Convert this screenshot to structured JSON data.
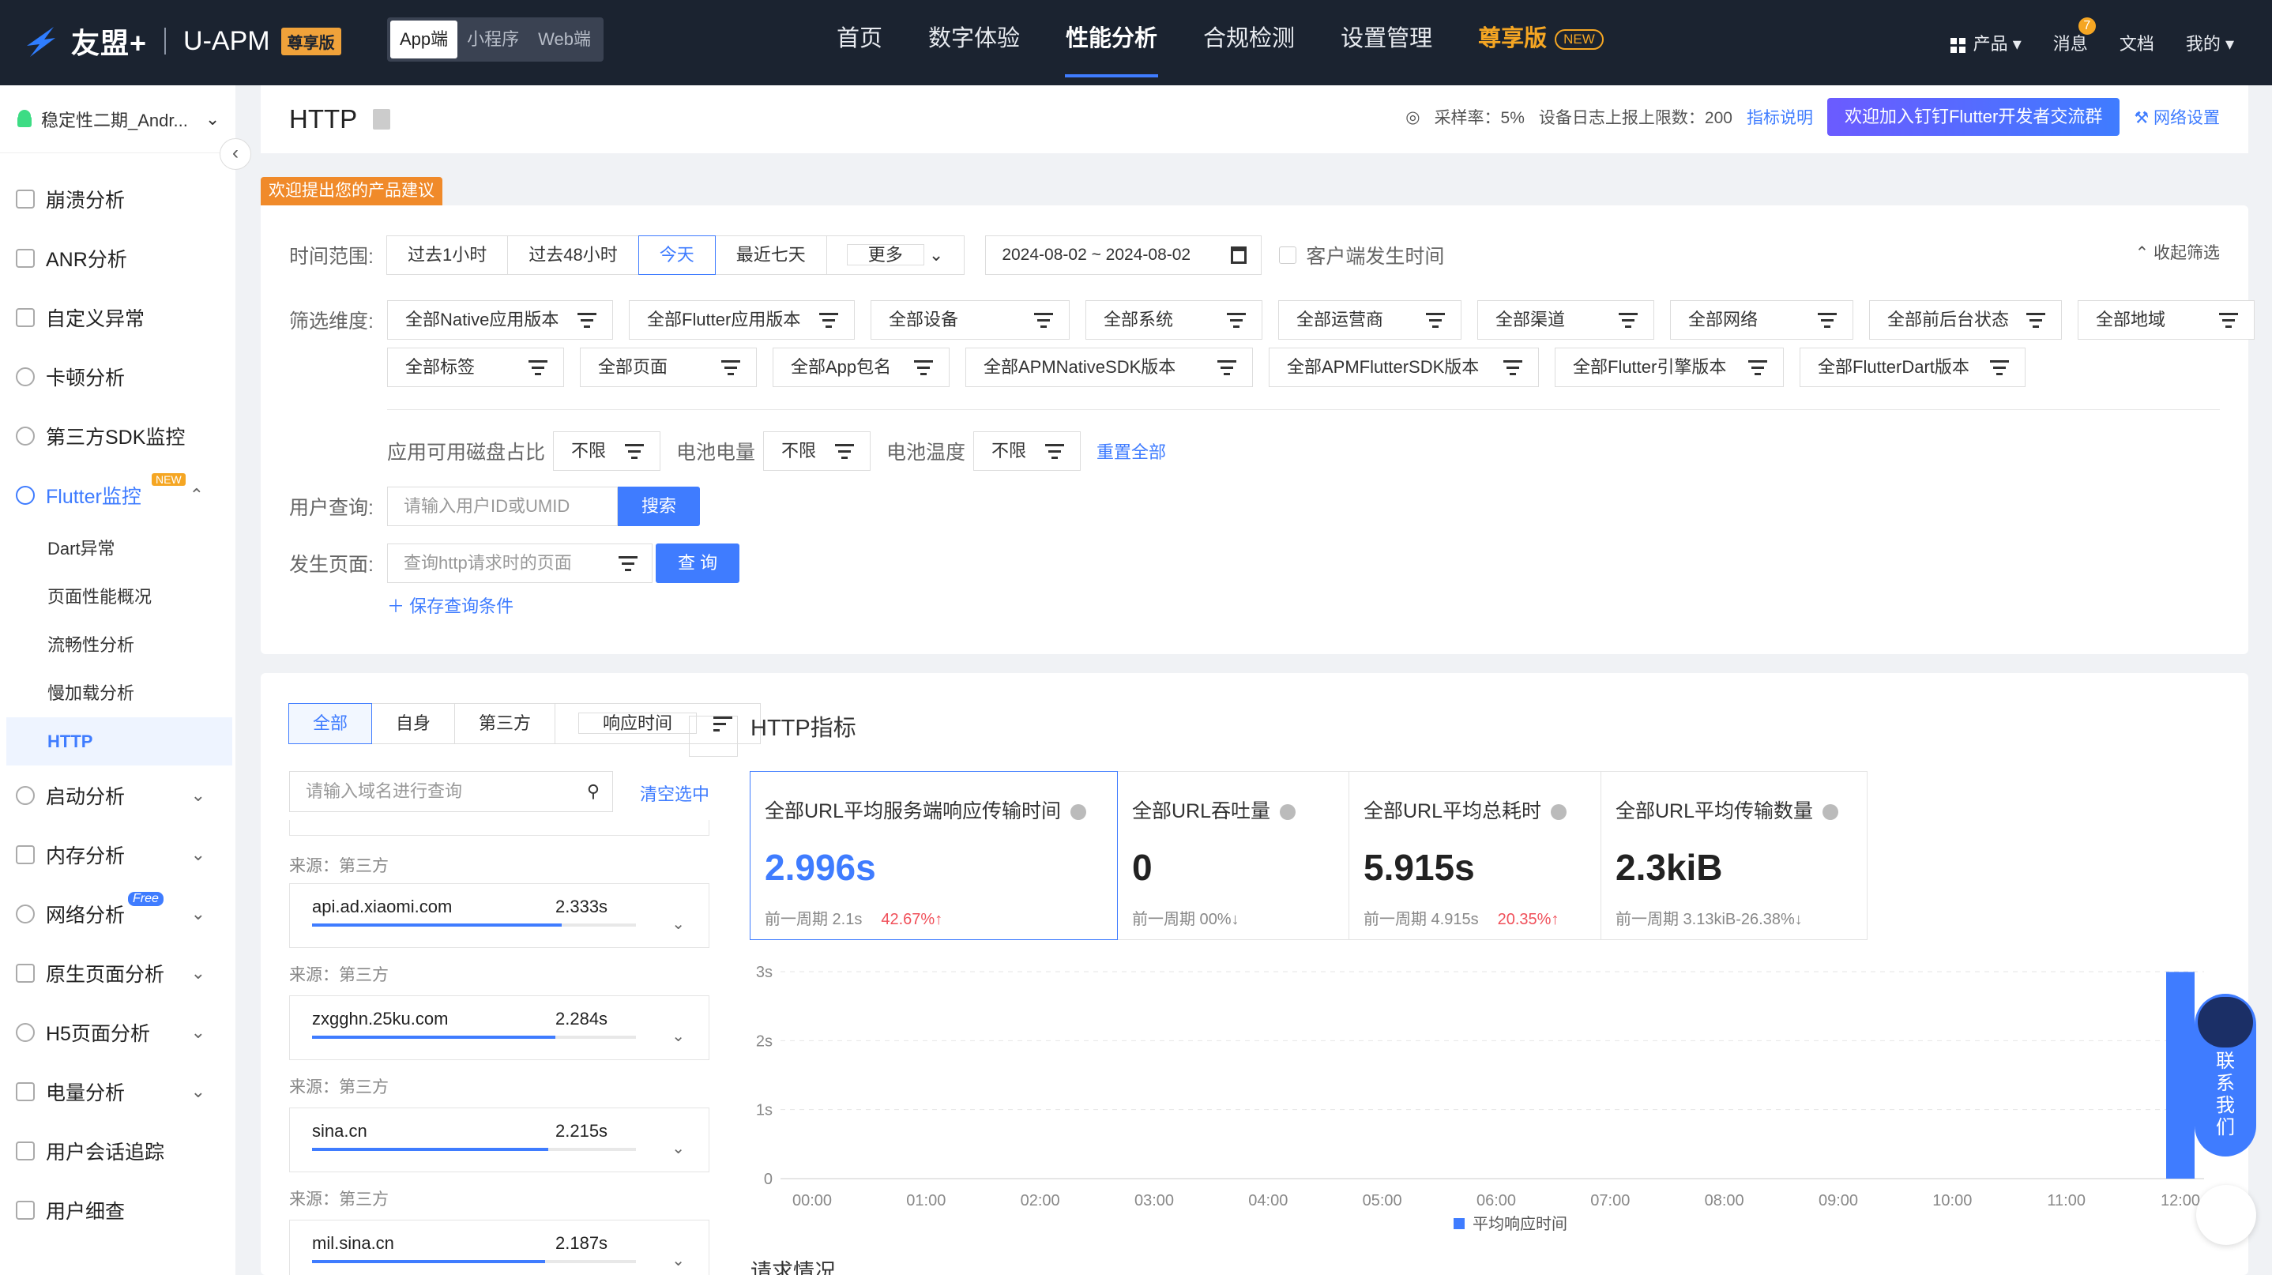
{
  "header": {
    "brand": "友盟+",
    "product": "U-APM",
    "edition": "尊享版",
    "platforms": [
      "App端",
      "小程序",
      "Web端"
    ],
    "nav": [
      {
        "label": "首页"
      },
      {
        "label": "数字体验"
      },
      {
        "label": "性能分析"
      },
      {
        "label": "合规检测"
      },
      {
        "label": "设置管理"
      },
      {
        "label": "尊享版",
        "tag": "NEW"
      }
    ],
    "right": {
      "products": "产品",
      "messages": "消息",
      "message_count": "7",
      "docs": "文档",
      "mine": "我的"
    }
  },
  "sidebar": {
    "app": "稳定性二期_Andr...",
    "items": [
      {
        "label": "崩溃分析"
      },
      {
        "label": "ANR分析"
      },
      {
        "label": "自定义异常"
      },
      {
        "label": "卡顿分析"
      },
      {
        "label": "第三方SDK监控"
      },
      {
        "label": "Flutter监控",
        "tag": "NEW"
      }
    ],
    "flutter_sub": [
      "Dart异常",
      "页面性能概况",
      "流畅性分析",
      "慢加载分析",
      "HTTP"
    ],
    "items2": [
      {
        "label": "启动分析"
      },
      {
        "label": "内存分析"
      },
      {
        "label": "网络分析",
        "tag": "Free"
      },
      {
        "label": "原生页面分析"
      },
      {
        "label": "H5页面分析"
      },
      {
        "label": "电量分析"
      },
      {
        "label": "用户会话追踪"
      },
      {
        "label": "用户细查"
      }
    ]
  },
  "titlebar": {
    "title": "HTTP",
    "sampling": "采样率：5%",
    "limit": "设备日志上报上限数：200",
    "metric_help": "指标说明",
    "join": "欢迎加入钉钉Flutter开发者交流群",
    "network": "网络设置"
  },
  "suggest": "欢迎提出您的产品建议",
  "filters": {
    "time_label": "时间范围:",
    "time_options": [
      "过去1小时",
      "过去48小时",
      "今天",
      "最近七天",
      "更多"
    ],
    "date_range": "2024-08-02 ~ 2024-08-02",
    "client_time": "客户端发生时间",
    "collapse": "收起筛选",
    "dim_label": "筛选维度:",
    "dims_row1": [
      "全部Native应用版本",
      "全部Flutter应用版本",
      "全部设备",
      "全部系统",
      "全部运营商",
      "全部渠道",
      "全部网络",
      "全部前后台状态",
      "全部地域"
    ],
    "dims_row2": [
      "全部标签",
      "全部页面",
      "全部App包名",
      "全部APMNativeSDK版本",
      "全部APMFlutterSDK版本",
      "全部Flutter引擎版本",
      "全部FlutterDart版本"
    ],
    "disk_label": "应用可用磁盘占比",
    "battery_label": "电池电量",
    "temp_label": "电池温度",
    "unlimited": "不限",
    "reset": "重置全部",
    "user_label": "用户查询:",
    "user_placeholder": "请输入用户ID或UMID",
    "search": "搜索",
    "page_label": "发生页面:",
    "page_placeholder": "查询http请求时的页面",
    "query": "查 询",
    "save": "保存查询条件"
  },
  "domains": {
    "tabs": [
      "全部",
      "自身",
      "第三方",
      "响应时间"
    ],
    "search_placeholder": "请输入域名进行查询",
    "clear": "清空选中",
    "source_prefix": "来源：第三方",
    "list": [
      {
        "name": "api.ad.xiaomi.com",
        "value": "2.333s",
        "ratio": 0.77
      },
      {
        "name": "zxgghn.25ku.com",
        "value": "2.284s",
        "ratio": 0.75
      },
      {
        "name": "sina.cn",
        "value": "2.215s",
        "ratio": 0.73
      },
      {
        "name": "mil.sina.cn",
        "value": "2.187s",
        "ratio": 0.72
      }
    ]
  },
  "metrics": {
    "title": "HTTP指标",
    "cards": [
      {
        "label": "全部URL平均服务端响应传输时间",
        "value": "2.996s",
        "prev": "前一周期 2.1s",
        "change": "42.67%",
        "dir": "up"
      },
      {
        "label": "全部URL吞吐量",
        "value": "0",
        "prev": "前一周期 0",
        "change": "0%",
        "dir": "down"
      },
      {
        "label": "全部URL平均总耗时",
        "value": "5.915s",
        "prev": "前一周期 4.915s",
        "change": "20.35%",
        "dir": "up"
      },
      {
        "label": "全部URL平均传输数量",
        "value": "2.3kiB",
        "prev": "前一周期 3.13kiB",
        "change": "-26.38%",
        "dir": "down"
      }
    ]
  },
  "chart_data": {
    "type": "bar",
    "categories": [
      "00:00",
      "01:00",
      "02:00",
      "03:00",
      "04:00",
      "05:00",
      "06:00",
      "07:00",
      "08:00",
      "09:00",
      "10:00",
      "11:00",
      "12:00"
    ],
    "series": [
      {
        "name": "平均响应时间",
        "values": [
          0,
          0,
          0,
          0,
          0,
          0,
          0,
          0,
          0,
          0,
          0,
          0,
          2.996
        ]
      }
    ],
    "yticks": [
      "0",
      "1s",
      "2s",
      "3s"
    ],
    "ylim": [
      0,
      3
    ],
    "color": "#3f7cff",
    "legend": "bottom"
  },
  "request_title": "请求情况",
  "contact": "联系我们",
  "colors": {
    "accent": "#3f7cff",
    "header": "#1b2330",
    "up": "#f0505a",
    "down": "#2bb673",
    "orange": "#f08a2a"
  }
}
